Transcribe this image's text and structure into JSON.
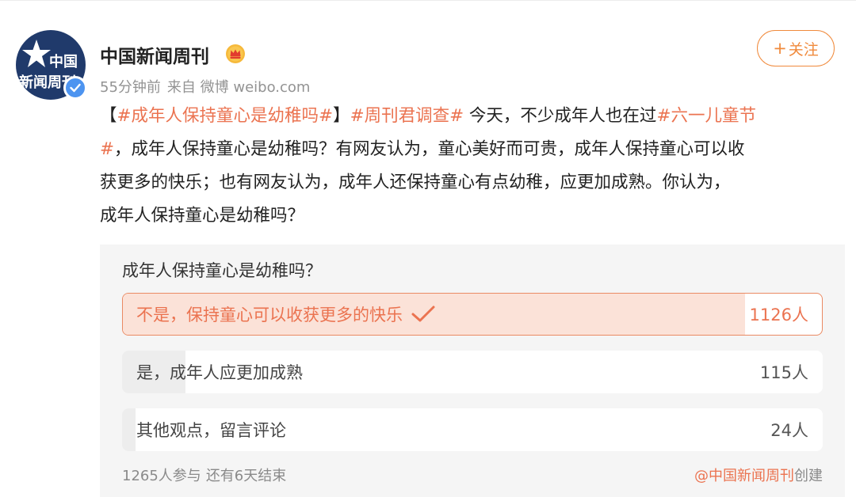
{
  "header": {
    "user_name": "中国新闻周刊",
    "avatar_text_line1": "中国",
    "avatar_text_line2": "新闻周刊",
    "time": "55分钟前",
    "source": "来自 微博 weibo.com",
    "follow_label": "关注",
    "follow_plus": "+"
  },
  "post": {
    "line1": {
      "bracket_open": "【",
      "hashtag1": "#成年人保持童心是幼稚吗#",
      "bracket_close": "】",
      "hashtag2": "#周刊君调查#",
      "text1": " 今天，不少成年人也在过",
      "hashtag3_part1": "#六一儿童节"
    },
    "line2": {
      "hashtag3_part2": "#",
      "text": "，成年人保持童心是幼稚吗？有网友认为，童心美好而可贵，成年人保持童心可以收"
    },
    "line3": "获更多的快乐；也有网友认为，成年人还保持童心有点幼稚，应更加成熟。你认为，",
    "line4": "成年人保持童心是幼稚吗？"
  },
  "poll": {
    "question": "成年人保持童心是幼稚吗？",
    "options": [
      {
        "label": "不是，保持童心可以收获更多的快乐",
        "count": "1126人",
        "votes": 1126,
        "selected": true
      },
      {
        "label": "是，成年人应更加成熟",
        "count": "115人",
        "votes": 115,
        "selected": false
      },
      {
        "label": "其他观点，留言评论",
        "count": "24人",
        "votes": 24,
        "selected": false
      }
    ],
    "participants": "1265人参与",
    "remaining": "还有6天结束",
    "creator": "@中国新闻周刊",
    "created_suffix": "创建"
  },
  "colors": {
    "accent": "#eb7350",
    "follow_border": "#f08a3c",
    "verified_blue": "#4d94f0",
    "avatar_bg": "#203a6b"
  },
  "icons": [
    "star-icon",
    "verified-icon",
    "crown-icon",
    "check-icon"
  ]
}
